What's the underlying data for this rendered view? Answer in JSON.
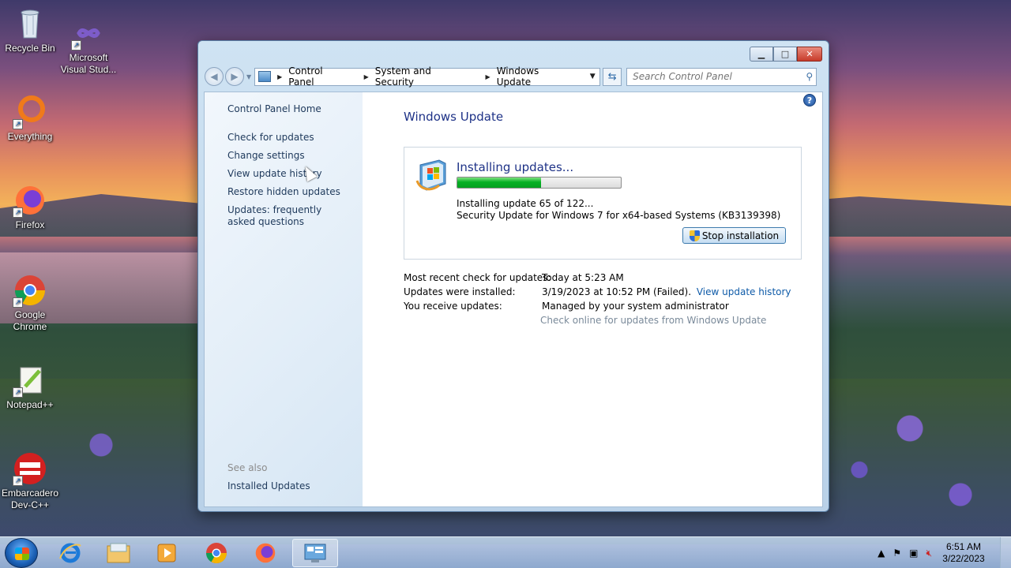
{
  "desktop": {
    "icons": [
      {
        "label": "Recycle Bin"
      },
      {
        "label": "Microsoft Visual Stud..."
      },
      {
        "label": "Everything"
      },
      {
        "label": "Firefox"
      },
      {
        "label": "Google Chrome"
      },
      {
        "label": "Notepad++"
      },
      {
        "label": "Embarcadero Dev-C++"
      }
    ]
  },
  "window": {
    "address": {
      "crumbs": [
        "Control Panel",
        "System and Security",
        "Windows Update"
      ]
    },
    "search": {
      "placeholder": "Search Control Panel"
    },
    "sidebar": {
      "home": "Control Panel Home",
      "links": [
        "Check for updates",
        "Change settings",
        "View update history",
        "Restore hidden updates",
        "Updates: frequently asked questions"
      ],
      "see_also": "See also",
      "installed_updates": "Installed Updates"
    },
    "main": {
      "title": "Windows Update",
      "status": {
        "heading": "Installing updates...",
        "progress_percent": 51,
        "line1": "Installing update 65 of 122...",
        "line2": "Security Update for Windows 7 for x64-based Systems (KB3139398)",
        "stop_label": "Stop installation"
      },
      "info": {
        "recent_check_label": "Most recent check for updates:",
        "recent_check_value": "Today at 5:23 AM",
        "installed_label": "Updates were installed:",
        "installed_value": "3/19/2023 at 10:52 PM (Failed).",
        "installed_link": "View update history",
        "receive_label": "You receive updates:",
        "receive_value": "Managed by your system administrator",
        "check_online": "Check online for updates from Windows Update"
      }
    }
  },
  "taskbar": {
    "time": "6:51 AM",
    "date": "3/22/2023"
  }
}
